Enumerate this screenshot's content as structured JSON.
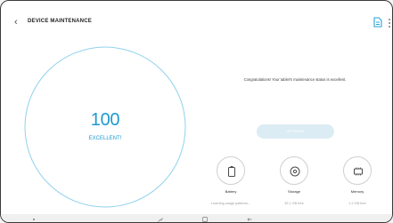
{
  "header": {
    "title": "DEVICE MAINTENANCE"
  },
  "score": {
    "value": "100",
    "status": "EXCELLENT!"
  },
  "message": "Congratulations! Your tablet's maintenance status is excellent.",
  "optimize_label": "OPTIMIZE",
  "features": [
    {
      "name": "Battery",
      "sub": "Learning usage patterns..."
    },
    {
      "name": "Storage",
      "sub": "32.1 GB free"
    },
    {
      "name": "Memory",
      "sub": "1.2 GB free"
    }
  ],
  "colors": {
    "accent": "#1c9ad1",
    "ring": "#8fd2ec",
    "button": "#dcecf4"
  }
}
